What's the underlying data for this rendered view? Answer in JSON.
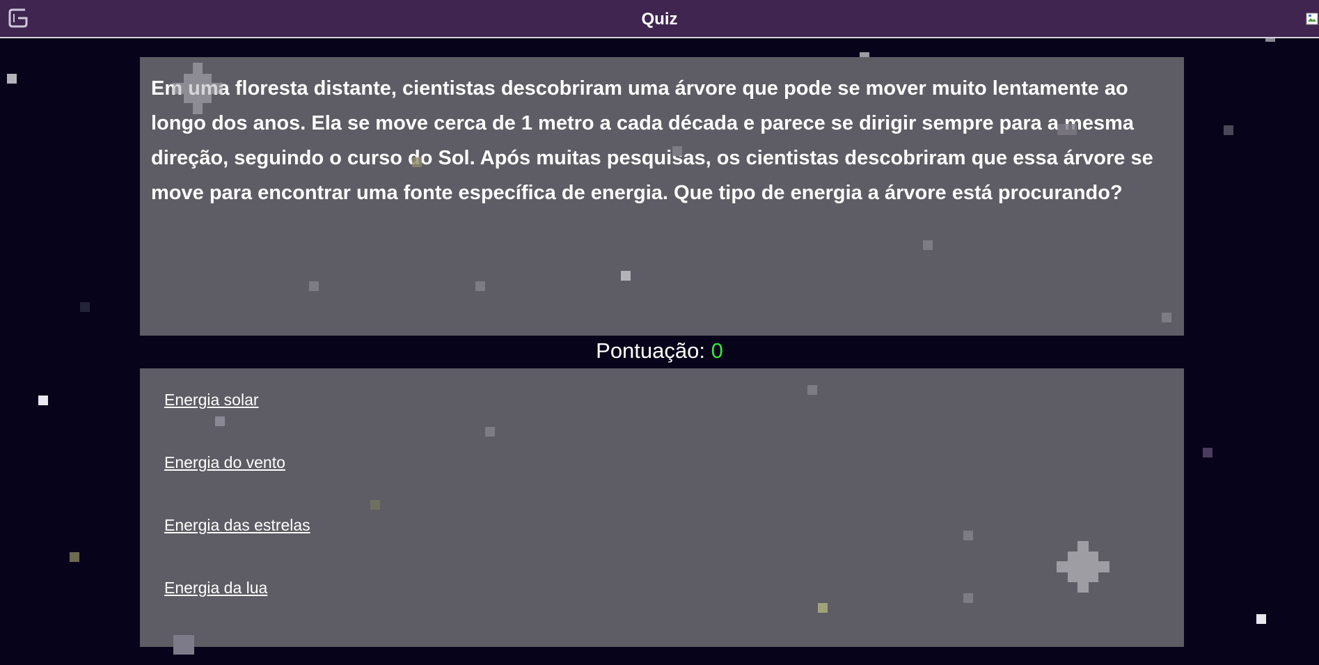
{
  "header": {
    "title": "Quiz",
    "logo_icon": "g-logo-icon",
    "broken_image_icon": "broken-image-icon",
    "background_color": "#3f2550"
  },
  "question": {
    "text": "Em uma floresta distante, cientistas descobriram uma árvore que pode se mover muito lentamente ao longo dos anos. Ela se move cerca de 1 metro a cada década e parece se dirigir sempre para a mesma direção, seguindo o curso do Sol. Após muitas pesquisas, os cientistas descobriram que essa árvore se move para encontrar uma fonte específica de energia. Que tipo de energia a árvore está procurando?"
  },
  "score": {
    "label": "Pontuação: ",
    "value": "0",
    "value_color": "#35e83a"
  },
  "answers": [
    {
      "label": "Energia solar"
    },
    {
      "label": "Energia do vento"
    },
    {
      "label": "Energia das estrelas"
    },
    {
      "label": "Energia da lua"
    }
  ],
  "colors": {
    "page_background": "#07031a",
    "panel_background": "#5e5c64",
    "text": "#ffffff"
  }
}
